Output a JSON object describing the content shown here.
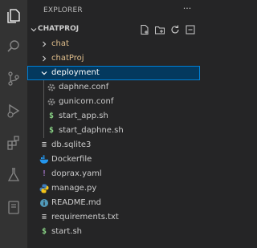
{
  "explorer": {
    "title": "EXPLORER"
  },
  "section": {
    "title": "CHATPROJ"
  },
  "tree": [
    {
      "label": "chat",
      "kind": "folder",
      "expanded": false
    },
    {
      "label": "chatProj",
      "kind": "folder",
      "expanded": false
    },
    {
      "label": "deployment",
      "kind": "folder",
      "expanded": true,
      "selected": true
    },
    {
      "label": "daphne.conf",
      "kind": "file",
      "icon": "gear-icon"
    },
    {
      "label": "gunicorn.conf",
      "kind": "file",
      "icon": "gear-icon"
    },
    {
      "label": "start_app.sh",
      "kind": "file",
      "icon": "shell-script-icon"
    },
    {
      "label": "start_daphne.sh",
      "kind": "file",
      "icon": "shell-script-icon"
    },
    {
      "label": "db.sqlite3",
      "kind": "file",
      "icon": "list-file-icon"
    },
    {
      "label": "Dockerfile",
      "kind": "file",
      "icon": "docker-icon"
    },
    {
      "label": "doprax.yaml",
      "kind": "file",
      "icon": "yaml-icon"
    },
    {
      "label": "manage.py",
      "kind": "file",
      "icon": "python-icon"
    },
    {
      "label": "README.md",
      "kind": "file",
      "icon": "info-icon"
    },
    {
      "label": "requirements.txt",
      "kind": "file",
      "icon": "list-file-icon"
    },
    {
      "label": "start.sh",
      "kind": "file",
      "icon": "shell-script-icon"
    }
  ],
  "glyphs": {
    "shell": "$",
    "yaml": "!",
    "list": "≡",
    "ellipsis": "···"
  },
  "colors": {
    "accent": "#007fd4",
    "selection": "#04395e",
    "modified_folder": "#e2c08d",
    "shell": "#89d185",
    "yaml": "#a074c4",
    "docker": "#2496ed",
    "python": "#3b7bbf"
  }
}
